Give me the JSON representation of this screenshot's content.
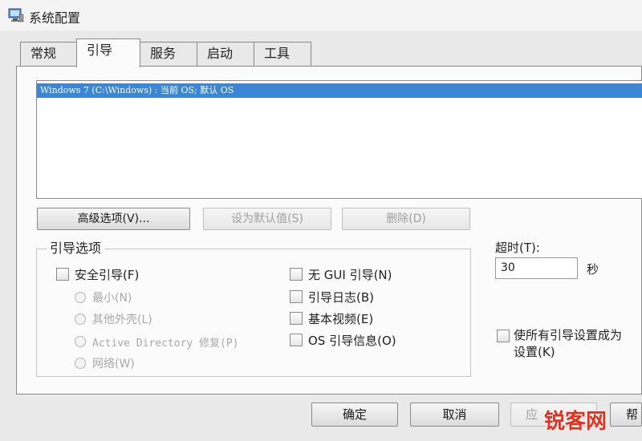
{
  "window": {
    "title": "系统配置",
    "icon": "computer-icon"
  },
  "tabs": [
    {
      "label": "常规",
      "active": false
    },
    {
      "label": "引导",
      "active": true
    },
    {
      "label": "服务",
      "active": false
    },
    {
      "label": "启动",
      "active": false
    },
    {
      "label": "工具",
      "active": false
    }
  ],
  "boot_list": {
    "entries": [
      "Windows 7 (C:\\Windows) : 当前 OS; 默认 OS"
    ],
    "selected_index": 0
  },
  "list_buttons": {
    "advanced": "高级选项(V)...",
    "set_default": "设为默认值(S)",
    "delete": "删除(D)"
  },
  "boot_options": {
    "legend": "引导选项",
    "safe_boot": {
      "label": "安全引导(F)",
      "checked": false
    },
    "safe_modes": [
      "最小(N)",
      "其他外壳(L)",
      "Active Directory 修复(P)",
      "网络(W)"
    ],
    "no_gui": {
      "label": "无 GUI 引导(N)",
      "checked": false
    },
    "boot_log": {
      "label": "引导日志(B)",
      "checked": false
    },
    "base_video": {
      "label": "基本视频(E)",
      "checked": false
    },
    "os_info": {
      "label": "OS 引导信息(O)",
      "checked": false
    }
  },
  "timeout": {
    "label": "超时(T):",
    "value": "30",
    "unit": "秒"
  },
  "make_permanent": {
    "label_line1": "使所有引导设置成为",
    "label_line2": "设置(K)",
    "checked": false
  },
  "dialog_buttons": {
    "ok": "确定",
    "cancel": "取消",
    "apply": "应",
    "help": "帮"
  },
  "watermark": {
    "text": "锐客网",
    "color": "#e4301c"
  },
  "colors": {
    "selection": "#3b86d6",
    "panel": "#fbfbfb",
    "window": "#e9e9e9"
  }
}
